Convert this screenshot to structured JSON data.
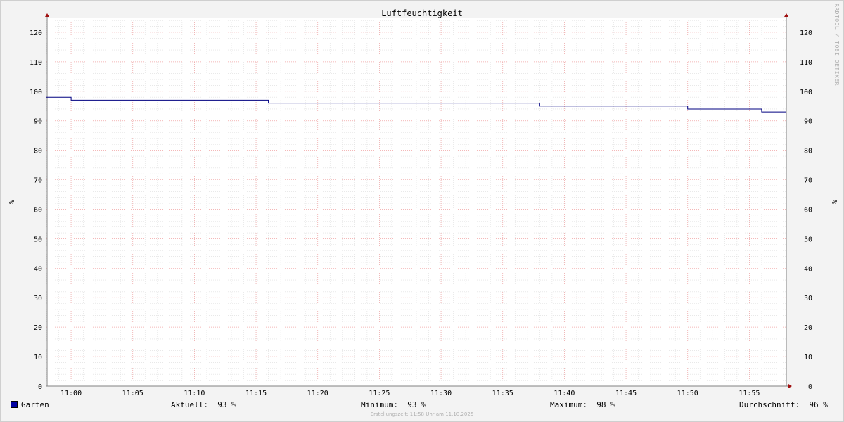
{
  "chart_data": {
    "type": "line",
    "title": "Luftfeuchtigkeit",
    "ylabel": "%",
    "ylim": [
      0,
      125
    ],
    "yticks": [
      0,
      10,
      20,
      30,
      40,
      50,
      60,
      70,
      80,
      90,
      100,
      110,
      120
    ],
    "x_range": [
      "10:58",
      "11:58"
    ],
    "xticks": [
      "11:00",
      "11:05",
      "11:10",
      "11:15",
      "11:20",
      "11:25",
      "11:30",
      "11:35",
      "11:40",
      "11:45",
      "11:50",
      "11:55"
    ],
    "grid": true,
    "series": [
      {
        "name": "Garten",
        "color": "#000080",
        "points": [
          [
            "10:58",
            98
          ],
          [
            "11:00",
            98
          ],
          [
            "11:00",
            97
          ],
          [
            "11:16",
            97
          ],
          [
            "11:16",
            96
          ],
          [
            "11:38",
            96
          ],
          [
            "11:38",
            95
          ],
          [
            "11:50",
            95
          ],
          [
            "11:50",
            94
          ],
          [
            "11:56",
            94
          ],
          [
            "11:56",
            93
          ],
          [
            "11:58",
            93
          ]
        ]
      }
    ],
    "watermark": "RRDTOOL / TOBI OETIKER"
  },
  "legend": {
    "series_name": "Garten",
    "swatch_color": "#0000a0",
    "aktuell_label": "Aktuell:",
    "aktuell_value": "93 %",
    "minimum_label": "Minimum:",
    "minimum_value": "93 %",
    "maximum_label": "Maximum:",
    "maximum_value": "98 %",
    "durchschnitt_label": "Durchschnitt:",
    "durchschnitt_value": "96 %"
  },
  "footer": "Erstellungszeit: 11:58 Uhr am 11.10.2025"
}
